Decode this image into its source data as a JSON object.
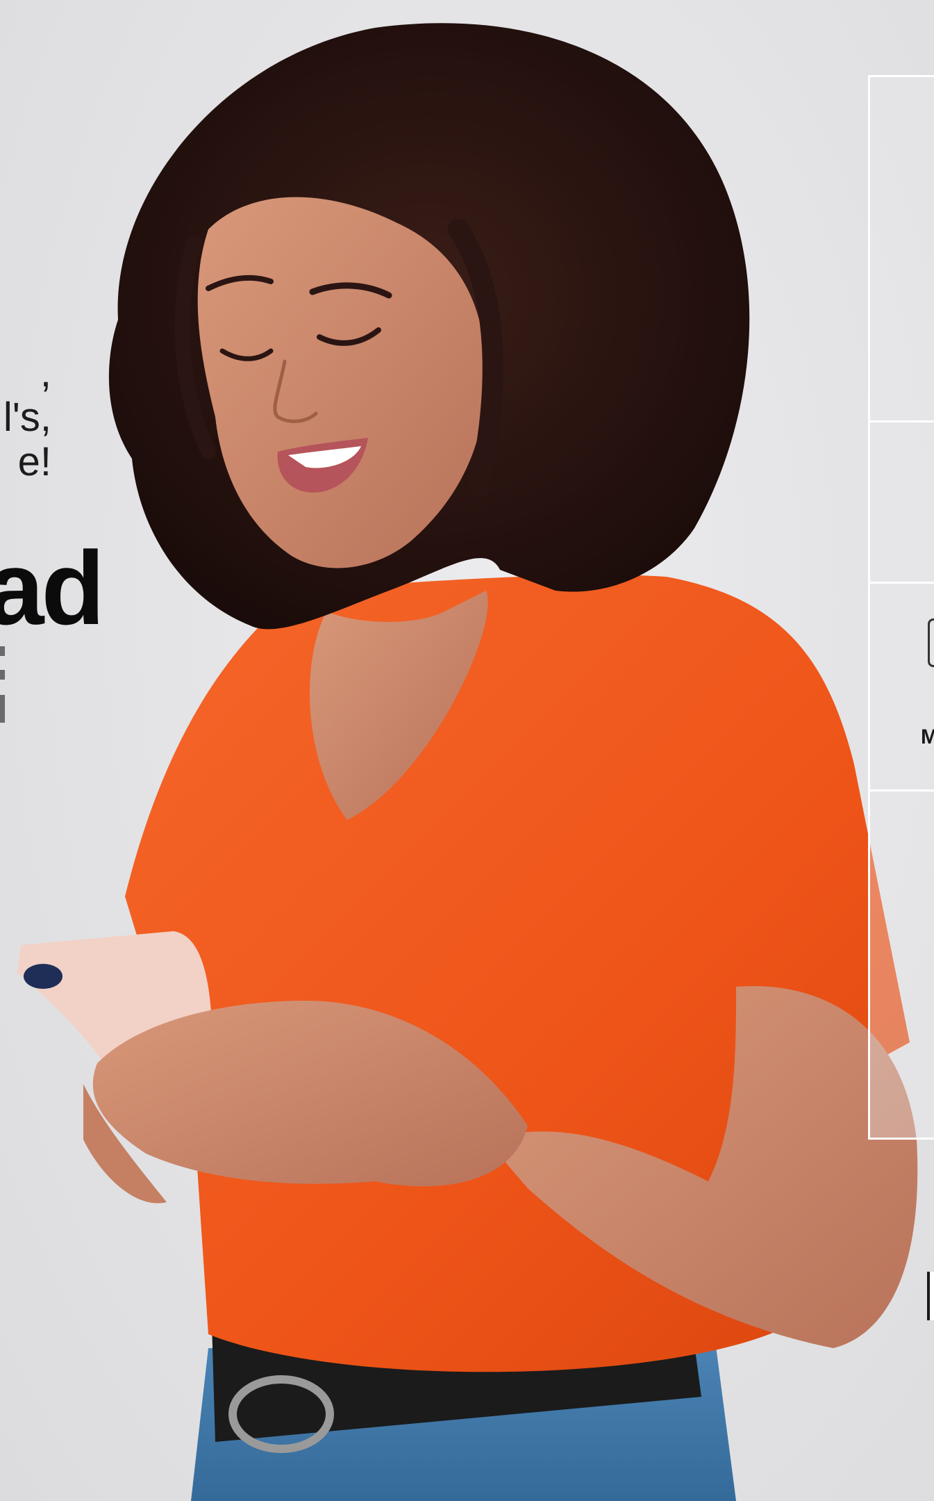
{
  "hero": {
    "tagline_lines": [
      ",",
      "l's,",
      "e!"
    ],
    "headline": "ad"
  },
  "panel": {
    "label": "M"
  },
  "photo": {
    "alt_icon": "woman-with-phone-photo",
    "colors": {
      "shirt": "#f0581e",
      "hair": "#2a1512",
      "skin": "#c9866a",
      "jeans": "#3f76a6",
      "phone": "#f2d1c6",
      "belt": "#1b1b1b"
    }
  }
}
